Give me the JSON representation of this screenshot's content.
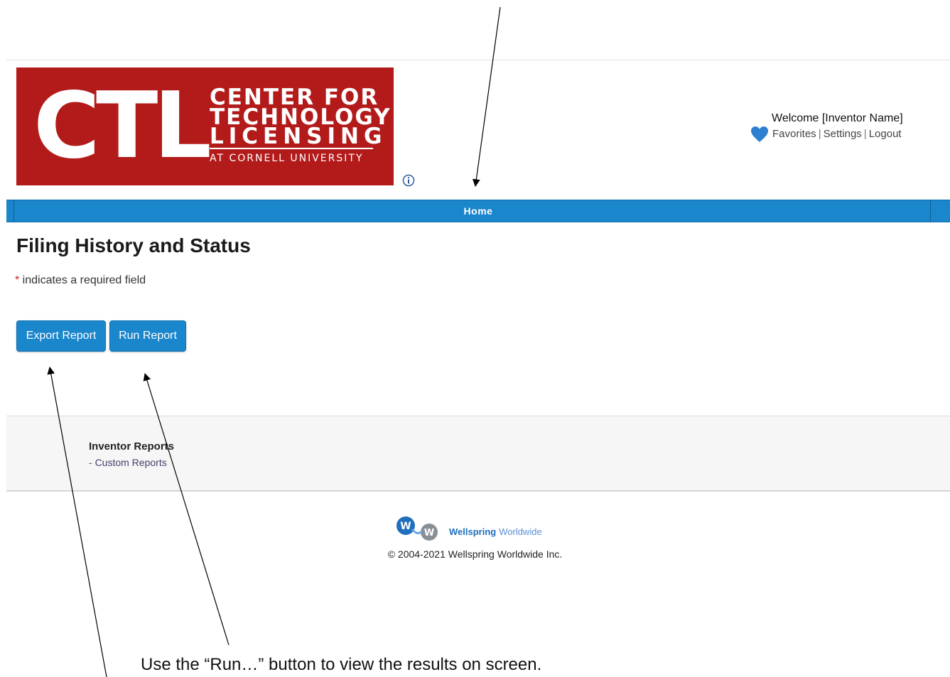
{
  "logo": {
    "big": "CTL",
    "line1": "CENTER FOR",
    "line2": "TECHNOLOGY",
    "line3": "LICENSING",
    "line4": "AT CORNELL UNIVERSITY"
  },
  "header": {
    "welcome": "Welcome [Inventor Name]",
    "links": {
      "favorites": "Favorites",
      "settings": "Settings",
      "logout": "Logout",
      "separator": "|"
    }
  },
  "nav": {
    "home": "Home"
  },
  "main": {
    "title": "Filing History and Status",
    "required_star": "*",
    "required_note": " indicates a required field",
    "buttons": {
      "export": "Export Report",
      "run": "Run Report"
    }
  },
  "footer": {
    "section_title": "Inventor Reports",
    "link_prefix": "- ",
    "link": "Custom Reports",
    "brand_bold": "Wellspring",
    "brand_light": "Worldwide",
    "copyright": "© 2004-2021 Wellspring Worldwide Inc."
  },
  "annotation": {
    "caption": "Use the “Run…” button to view the results on screen."
  },
  "colors": {
    "brand_red": "#b31b1b",
    "nav_blue": "#1a86cc",
    "button_blue": "#1a86cc"
  }
}
